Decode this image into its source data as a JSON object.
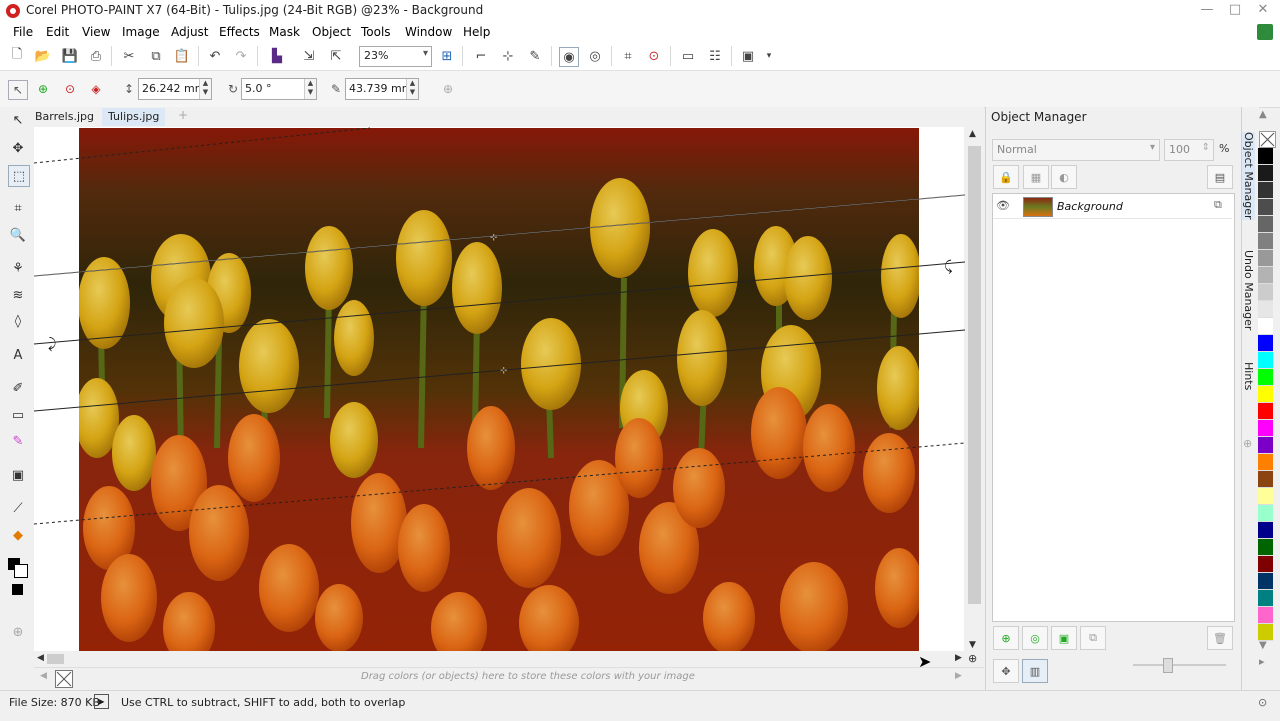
{
  "window": {
    "title": "Corel PHOTO-PAINT X7 (64-Bit) - Tulips.jpg (24-Bit RGB) @23% - Background",
    "minimize": "—",
    "maximize": "□",
    "close": "✕"
  },
  "menu": [
    "File",
    "Edit",
    "View",
    "Image",
    "Adjust",
    "Effects",
    "Mask",
    "Object",
    "Tools",
    "Window",
    "Help"
  ],
  "toolbar": {
    "zoom_value": "23%"
  },
  "property_bar": {
    "width_value": "26.242 mm",
    "angle_value": "5.0 °",
    "feather_value": "43.739 mm"
  },
  "doc_tabs": [
    "Barrels.jpg",
    "Tulips.jpg"
  ],
  "color_tray": {
    "hint": "Drag colors (or objects) here to store these colors with your image"
  },
  "object_manager": {
    "title": "Object Manager",
    "blend_mode": "Normal",
    "opacity": "100",
    "opacity_unit": "%",
    "layers": [
      {
        "name": "Background"
      }
    ]
  },
  "side_tabs": [
    "Object Manager",
    "Undo Manager",
    "Hints"
  ],
  "palette": [
    "#ffffff",
    "#000000",
    "#1a1a1a",
    "#333333",
    "#4d4d4d",
    "#666666",
    "#808080",
    "#999999",
    "#b3b3b3",
    "#cccccc",
    "#e6e6e6",
    "#ffffff",
    "#0000ff",
    "#00ffff",
    "#00ff00",
    "#ffff00",
    "#ff0000",
    "#ff00ff",
    "#7a00c8",
    "#ff8000",
    "#8b4513",
    "#ffff99",
    "#99ffcc",
    "#00008b",
    "#006400",
    "#7f0000",
    "#003366",
    "#008080",
    "#ff66cc",
    "#cccc00"
  ],
  "status": {
    "file_size": "File Size: 870 KB",
    "message": "Use CTRL to subtract, SHIFT to add, both to overlap"
  }
}
